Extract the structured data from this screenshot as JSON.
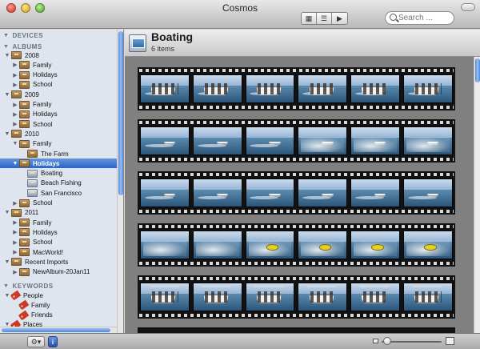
{
  "window": {
    "title": "Cosmos"
  },
  "toolbar": {
    "view_modes": [
      {
        "icon": "grid-view-icon",
        "glyph": "▦"
      },
      {
        "icon": "list-view-icon",
        "glyph": "☰"
      },
      {
        "icon": "slideshow-view-icon",
        "glyph": "▶"
      }
    ],
    "active_view": 1,
    "search": {
      "placeholder": "Search ...",
      "value": ""
    }
  },
  "sidebar": {
    "sections": {
      "devices": "DEVICES",
      "albums": "ALBUMS",
      "keywords": "KEYWORDS"
    },
    "items": [
      {
        "label": "2008",
        "level": 1,
        "icon": "film-roll-icon",
        "disclosure": "open"
      },
      {
        "label": "Family",
        "level": 2,
        "icon": "film-roll-icon",
        "disclosure": "closed"
      },
      {
        "label": "Holidays",
        "level": 2,
        "icon": "film-roll-icon",
        "disclosure": "closed"
      },
      {
        "label": "School",
        "level": 2,
        "icon": "film-roll-icon",
        "disclosure": "closed"
      },
      {
        "label": "2009",
        "level": 1,
        "icon": "film-roll-icon",
        "disclosure": "open"
      },
      {
        "label": "Family",
        "level": 2,
        "icon": "film-roll-icon",
        "disclosure": "closed"
      },
      {
        "label": "Holidays",
        "level": 2,
        "icon": "film-roll-icon",
        "disclosure": "closed"
      },
      {
        "label": "School",
        "level": 2,
        "icon": "film-roll-icon",
        "disclosure": "closed"
      },
      {
        "label": "2010",
        "level": 1,
        "icon": "film-roll-icon",
        "disclosure": "open"
      },
      {
        "label": "Family",
        "level": 2,
        "icon": "film-roll-icon",
        "disclosure": "open"
      },
      {
        "label": "The Farm",
        "level": 3,
        "icon": "film-roll-icon",
        "disclosure": "none"
      },
      {
        "label": "Holidays",
        "level": 2,
        "icon": "film-roll-icon",
        "disclosure": "open",
        "selected": true
      },
      {
        "label": "Boating",
        "level": 3,
        "icon": "album-icon",
        "disclosure": "none"
      },
      {
        "label": "Beach Fishing",
        "level": 3,
        "icon": "album-icon",
        "disclosure": "none"
      },
      {
        "label": "San Francisco",
        "level": 3,
        "icon": "album-icon",
        "disclosure": "none"
      },
      {
        "label": "School",
        "level": 2,
        "icon": "film-roll-icon",
        "disclosure": "closed"
      },
      {
        "label": "2011",
        "level": 1,
        "icon": "film-roll-icon",
        "disclosure": "open"
      },
      {
        "label": "Family",
        "level": 2,
        "icon": "film-roll-icon",
        "disclosure": "closed"
      },
      {
        "label": "Holidays",
        "level": 2,
        "icon": "film-roll-icon",
        "disclosure": "closed"
      },
      {
        "label": "School",
        "level": 2,
        "icon": "film-roll-icon",
        "disclosure": "closed"
      },
      {
        "label": "MacWorld!",
        "level": 2,
        "icon": "film-roll-icon",
        "disclosure": "closed"
      },
      {
        "label": "Recent Imports",
        "level": 1,
        "icon": "film-roll-icon",
        "disclosure": "open"
      },
      {
        "label": "NewAlbum-20Jan11",
        "level": 2,
        "icon": "film-roll-icon",
        "disclosure": "closed"
      }
    ],
    "keywords": [
      {
        "label": "People",
        "level": 1,
        "icon": "tag-icon",
        "disclosure": "open"
      },
      {
        "label": "Family",
        "level": 2,
        "icon": "tag-icon",
        "disclosure": "none"
      },
      {
        "label": "Friends",
        "level": 2,
        "icon": "tag-icon",
        "disclosure": "none"
      },
      {
        "label": "Places",
        "level": 1,
        "icon": "tag-icon",
        "disclosure": "open"
      }
    ]
  },
  "main": {
    "album_title": "Boating",
    "item_count": "6 items",
    "strips": [
      [
        "boat",
        "boat",
        "boat",
        "boat",
        "boat",
        "boat"
      ],
      [
        "boat-far",
        "boat-far",
        "boat-far",
        "boat-wake",
        "boat-wake",
        "boat-wake"
      ],
      [
        "boat-far",
        "boat-far",
        "boat-far",
        "boat-far",
        "boat-far",
        "boat-far"
      ],
      [
        "spray",
        "spray",
        "tube",
        "tube",
        "tube",
        "tube"
      ],
      [
        "crowd",
        "crowd",
        "crowd",
        "crowd",
        "crowd",
        "crowd"
      ]
    ]
  },
  "colors": {
    "selection": "#2a65c8",
    "sidebar_bg": "#dfe5ee",
    "content_bg": "#808080",
    "film": "#121212"
  },
  "statusbar": {
    "action_menu_glyph": "⚙▾",
    "info_glyph": "i",
    "zoom_level": 0.05
  }
}
